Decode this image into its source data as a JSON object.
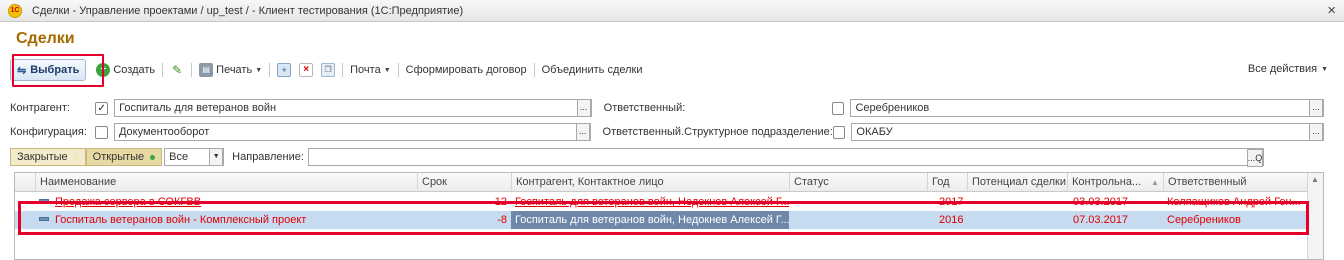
{
  "window": {
    "title": "Сделки - Управление проектами / up_test /  - Клиент тестирования (1С:Предприятие)",
    "close": "×"
  },
  "page": {
    "title": "Сделки"
  },
  "toolbar": {
    "select_label": "Выбрать",
    "create_label": "Создать",
    "print_label": "Печать",
    "mail_label": "Почта",
    "make_contract_label": "Сформировать договор",
    "merge_label": "Объединить сделки",
    "all_actions_label": "Все действия"
  },
  "filters": {
    "counterparty": {
      "label": "Контрагент:",
      "checked": true,
      "value": "Госпиталь для ветеранов войн"
    },
    "responsible": {
      "label": "Ответственный:",
      "checked": false,
      "value": "Серебреников"
    },
    "configuration": {
      "label": "Конфигурация:",
      "checked": false,
      "value": "Документооборот"
    },
    "responsible_unit": {
      "label": "Ответственный.Структурное подразделение:",
      "checked": false,
      "value": "ОКАБУ"
    },
    "closed_label": "Закрытые",
    "open_label": "Открытые",
    "status_select": "Все",
    "direction_label": "Направление:",
    "direction_value": ""
  },
  "table": {
    "columns": [
      "Наименование",
      "Срок",
      "Контрагент, Контактное лицо",
      "Статус",
      "Год",
      "Потенциал сделки",
      "Контрольна...",
      "Ответственный"
    ],
    "rows": [
      {
        "name": "Продажа сервера в СОКГВВ",
        "term": "-12",
        "counterparty": "Госпиталь для ветеранов войн, Недокнев Алексей Г...",
        "status": "",
        "year": "2017",
        "potential": "",
        "control_date": "03.03.2017",
        "responsible": "Колпащиков Андрей Ген..."
      },
      {
        "name": "Госпиталь ветеранов войн - Комплексный проект",
        "term": "-8",
        "counterparty": "Госпиталь для ветеранов войн, Недокнев Алексей Г...",
        "status": "",
        "year": "2016",
        "potential": "",
        "control_date": "07.03.2017",
        "responsible": "Серебреников"
      }
    ]
  },
  "colors": {
    "title": "#a86a00",
    "overdue_text": "#e00000",
    "selection": "#c6daf0",
    "highlight_frame": "#e4002b"
  }
}
